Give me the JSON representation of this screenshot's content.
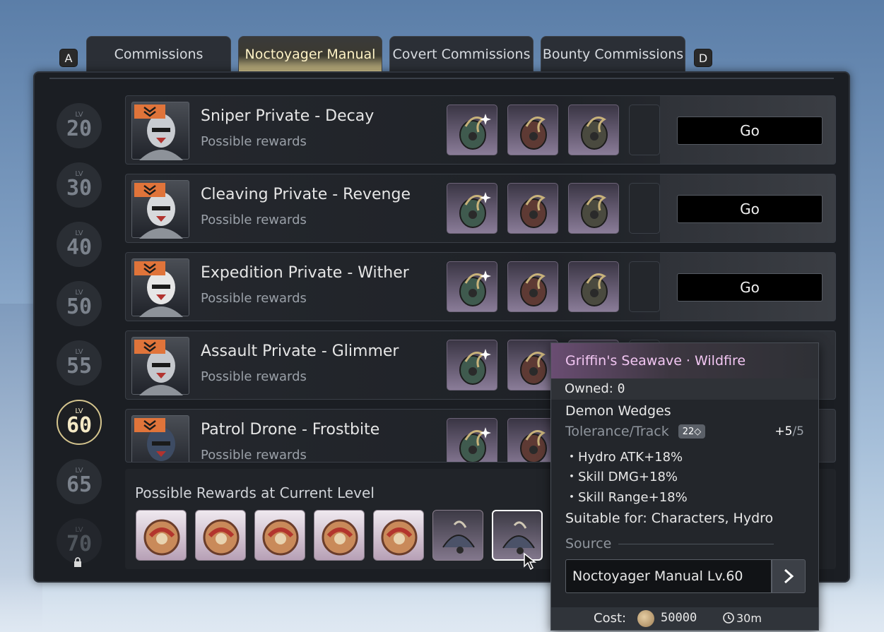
{
  "tabs": {
    "left_key": "A",
    "right_key": "D",
    "items": [
      {
        "label": "Commissions"
      },
      {
        "label": "Noctoyager Manual"
      },
      {
        "label": "Covert Commissions"
      },
      {
        "label": "Bounty Commissions"
      }
    ],
    "active_index": 1
  },
  "levels": [
    {
      "lv": "LV",
      "num": "20"
    },
    {
      "lv": "LV",
      "num": "30"
    },
    {
      "lv": "LV",
      "num": "40"
    },
    {
      "lv": "LV",
      "num": "50"
    },
    {
      "lv": "LV",
      "num": "55"
    },
    {
      "lv": "LV",
      "num": "60",
      "active": true
    },
    {
      "lv": "LV",
      "num": "65"
    },
    {
      "lv": "LV",
      "num": "70",
      "locked": true
    }
  ],
  "commissions": [
    {
      "title": "Sniper Private - Decay",
      "subtitle": "Possible rewards",
      "button": "Go"
    },
    {
      "title": "Cleaving Private - Revenge",
      "subtitle": "Possible rewards",
      "button": "Go"
    },
    {
      "title": "Expedition Private - Wither",
      "subtitle": "Possible rewards",
      "button": "Go"
    },
    {
      "title": "Assault Private - Glimmer",
      "subtitle": "Possible rewards"
    },
    {
      "title": "Patrol Drone - Frostbite",
      "subtitle": "Possible rewards"
    }
  ],
  "current_rewards": {
    "title": "Possible Rewards at Current Level",
    "count": 7,
    "selected_index": 6
  },
  "tooltip": {
    "name": "Griffin's Seawave · Wildfire",
    "name_color": "#f2c6f2",
    "owned_label": "Owned:",
    "owned_value": "0",
    "category": "Demon Wedges",
    "tolerance_label": "Tolerance/Track",
    "tolerance_badge": "22◇",
    "tolerance_current": "+5",
    "tolerance_max": "/5",
    "stats": [
      "・Hydro ATK+18%",
      "・Skill DMG+18%",
      "・Skill Range+18%"
    ],
    "suitable": "Suitable for: Characters, Hydro",
    "source_label": "Source",
    "source_value": "Noctoyager Manual Lv.60",
    "cost_label": "Cost:",
    "cost_value": "50000",
    "time_value": "30m"
  },
  "colors": {
    "accent_gold": "#d5c58e",
    "badge_orange": "#e0743a",
    "panel": "#1b1e23"
  }
}
